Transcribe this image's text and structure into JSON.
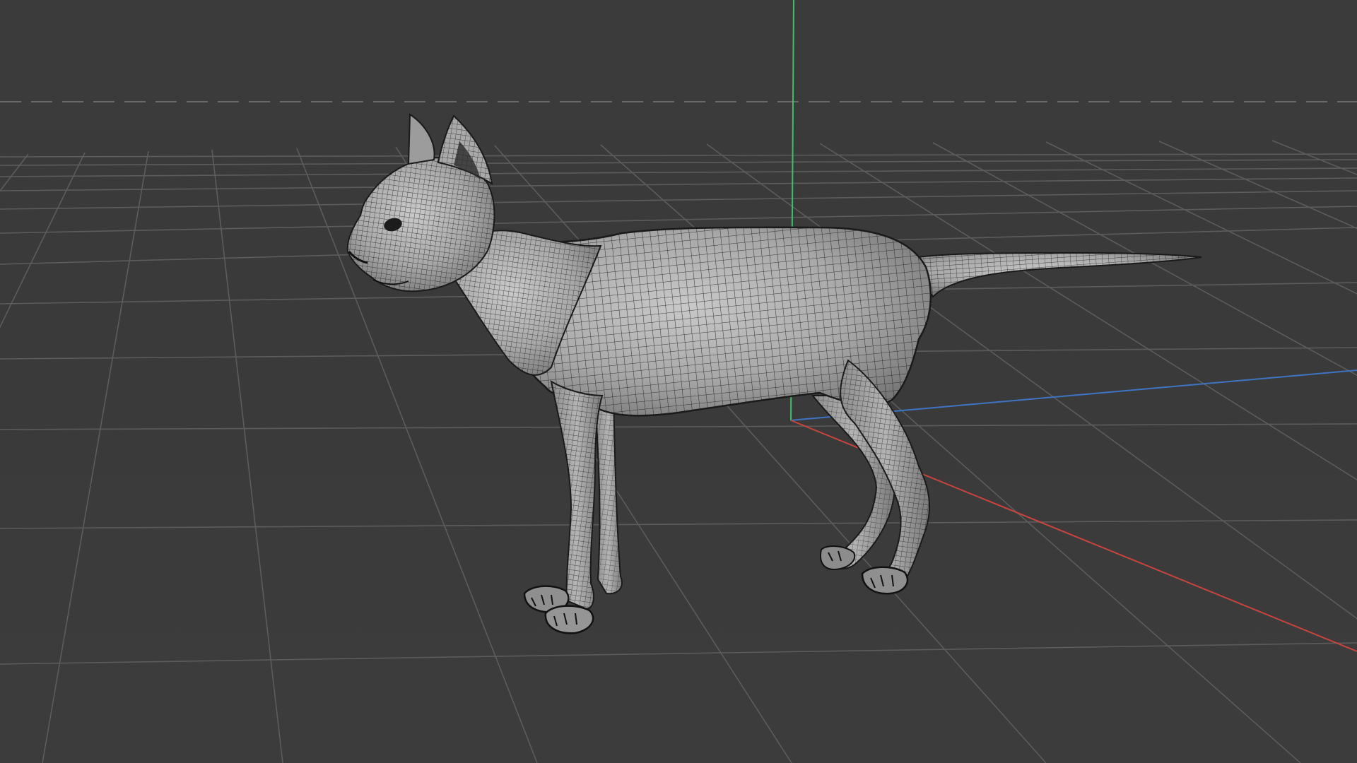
{
  "viewport": {
    "background": "#3a3a3a",
    "grid_color": "#5c5c5c",
    "horizon_line": "dashed",
    "axis_colors": {
      "x": "#c8443e",
      "y": "#3fbf6a",
      "z": "#3e74c4"
    }
  },
  "model": {
    "subject": "cat",
    "display_mode": "wireframe-on-shaded",
    "surface_color": "#a9a9a9",
    "wire_color": "#1a1a1a",
    "object_icon": "cat-mesh-icon"
  }
}
